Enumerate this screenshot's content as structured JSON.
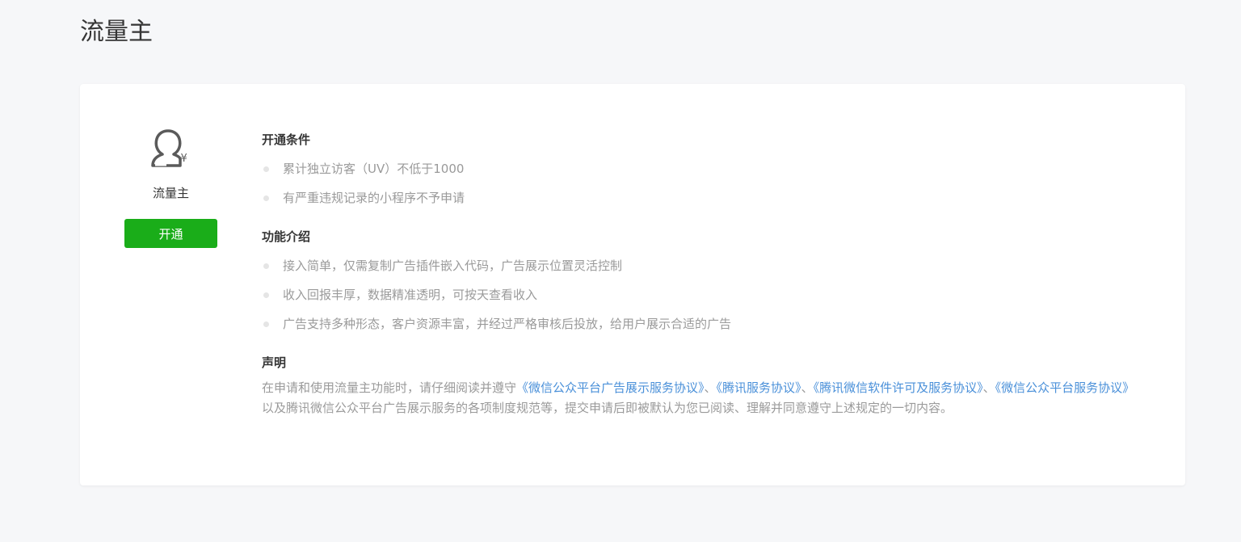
{
  "page": {
    "title": "流量主"
  },
  "product": {
    "icon": "user-yuan-icon",
    "icon_symbol": "¥",
    "name": "流量主",
    "open_button_label": "开通"
  },
  "colors": {
    "primary_button": "#1aad19",
    "link": "#4a90d9",
    "muted_text": "#9a9a9a",
    "background": "#f6f7f9"
  },
  "conditions": {
    "title": "开通条件",
    "items": [
      "累计独立访客（UV）不低于1000",
      "有严重违规记录的小程序不予申请"
    ]
  },
  "features": {
    "title": "功能介绍",
    "items": [
      "接入简单，仅需复制广告插件嵌入代码，广告展示位置灵活控制",
      "收入回报丰厚，数据精准透明，可按天查看收入",
      "广告支持多种形态，客户资源丰富，并经过严格审核后投放，给用户展示合适的广告"
    ]
  },
  "statement": {
    "title": "声明",
    "text_prefix": "在申请和使用流量主功能时，请仔细阅读并遵守",
    "link_1": "《微信公众平台广告展示服务协议》",
    "sep_1": "、",
    "link_2": "《腾讯服务协议》",
    "sep_2": "、",
    "link_3": "《腾讯微信软件许可及服务协议》",
    "sep_3": "、",
    "link_4": "《微信公众平台服务协议》",
    "text_suffix": "以及腾讯微信公众平台广告展示服务的各项制度规范等，提交申请后即被默认为您已阅读、理解并同意遵守上述规定的一切内容。"
  }
}
